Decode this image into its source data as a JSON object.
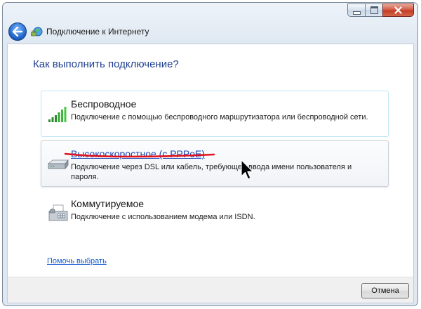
{
  "window": {
    "title": "Подключение к Интернету",
    "controls": [
      "minimize",
      "maximize",
      "close"
    ]
  },
  "header": {
    "back_icon": "back-arrow-icon",
    "app_icon": "network-globe-icon"
  },
  "main": {
    "heading": "Как выполнить подключение?",
    "options": [
      {
        "title": "Беспроводное",
        "description": "Подключение с помощью беспроводного маршрутизатора или беспроводной сети.",
        "icon": "wireless-signal-icon",
        "state": "focused"
      },
      {
        "title": "Высокоскоростное (с PPPoE)",
        "description": "Подключение через DSL или кабель, требующее ввода имени пользователя и пароля.",
        "icon": "broadband-modem-icon",
        "state": "hovered"
      },
      {
        "title": "Коммутируемое",
        "description": "Подключение с использованием модема или ISDN.",
        "icon": "dialup-fax-icon",
        "state": "normal"
      }
    ],
    "help_link": "Помочь выбрать"
  },
  "footer": {
    "cancel_label": "Отмена"
  },
  "colors": {
    "heading": "#1e3f91",
    "link": "#1a45b4",
    "annotation": "#e0141e",
    "close_button": "#c23a22"
  }
}
